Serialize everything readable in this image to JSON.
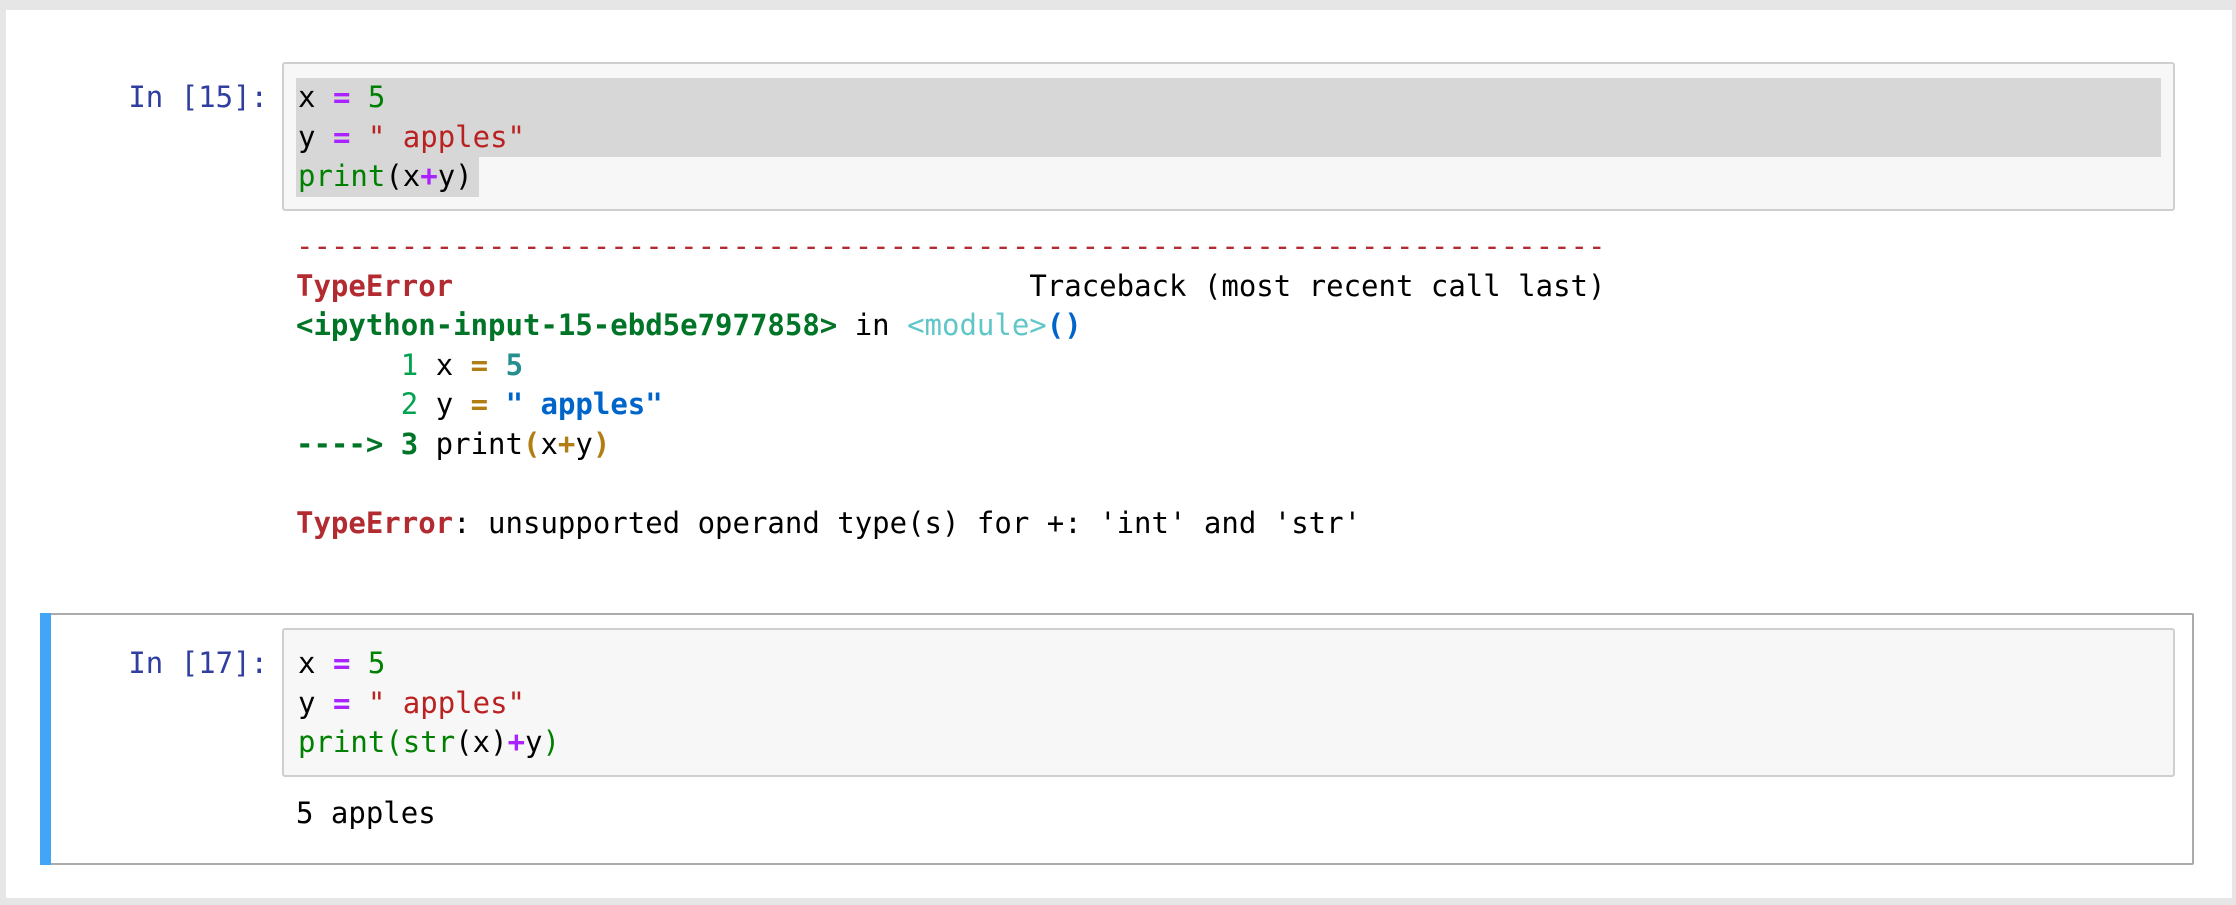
{
  "cells": [
    {
      "prompt": "In [15]:",
      "code": {
        "l1": {
          "a": "x",
          "b": " ",
          "c": "=",
          "d": " ",
          "e": "5"
        },
        "l2": {
          "a": "y",
          "b": " ",
          "c": "=",
          "d": " ",
          "e": "\" apples\""
        },
        "l3": {
          "a": "print",
          "b": "(x",
          "c": "+",
          "d": "y)"
        }
      },
      "traceback": {
        "rule": "---------------------------------------------------------------------------",
        "err_name": "TypeError",
        "header_gap": "                                 ",
        "header_right": "Traceback (most recent call last)",
        "location": "<ipython-input-15-ebd5e7977858>",
        "in_word": " in ",
        "module": "<module>",
        "parens": "()",
        "ctx1": {
          "indent": "      ",
          "num": "1",
          "a": " x ",
          "op": "=",
          "b": " ",
          "val": "5"
        },
        "ctx2": {
          "indent": "      ",
          "num": "2",
          "a": " y ",
          "op": "=",
          "b": " ",
          "val": "\" apples\""
        },
        "ctx3": {
          "arrow": "----> 3",
          "a": " print",
          "p1": "(",
          "b": "x",
          "op": "+",
          "c": "y",
          "p2": ")"
        },
        "final_name": "TypeError",
        "final_msg": ": unsupported operand type(s) for +: 'int' and 'str'"
      }
    },
    {
      "prompt": "In [17]:",
      "code": {
        "l1": {
          "a": "x",
          "b": " ",
          "c": "=",
          "d": " ",
          "e": "5"
        },
        "l2": {
          "a": "y",
          "b": " ",
          "c": "=",
          "d": " ",
          "e": "\" apples\""
        },
        "l3": {
          "a": "print",
          "b": "(",
          "c": "str",
          "d": "(x)",
          "e": "+",
          "f": "y",
          "g": ")"
        }
      },
      "output": "5 apples"
    }
  ]
}
